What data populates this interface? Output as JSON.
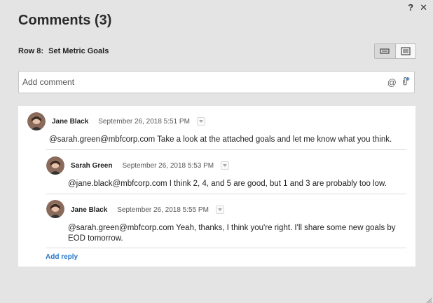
{
  "window": {
    "help_label": "?",
    "close_label": "✕"
  },
  "title": "Comments (3)",
  "row": {
    "number": "Row 8:",
    "name": "Set Metric Goals"
  },
  "view_toggle": {
    "options": [
      "compact-view-icon",
      "expanded-view-icon"
    ],
    "active": "compact-view-icon"
  },
  "add_comment": {
    "placeholder": "Add comment",
    "mention_icon": "@",
    "attach_icon": "attach-icon"
  },
  "comments": [
    {
      "author": "Jane Black",
      "date": "September 26, 2018 5:51 PM",
      "text": "@sarah.green@mbfcorp.com Take a look at the attached goals and let me know what you think."
    },
    {
      "author": "Sarah Green",
      "date": "September 26, 2018 5:53 PM",
      "text": "@jane.black@mbfcorp.com I think 2, 4, and 5 are good, but 1 and 3 are probably too low."
    },
    {
      "author": "Jane Black",
      "date": "September 26, 2018 5:55 PM",
      "text_line1": "@sarah.green@mbfcorp.com Yeah, thanks, I think you're right. I'll share some new goals by",
      "text_line2": "EOD tomorrow."
    }
  ],
  "add_reply_label": "Add reply",
  "colors": {
    "background": "#e4e4e4",
    "link": "#2b78c8",
    "panel": "#ffffff"
  }
}
